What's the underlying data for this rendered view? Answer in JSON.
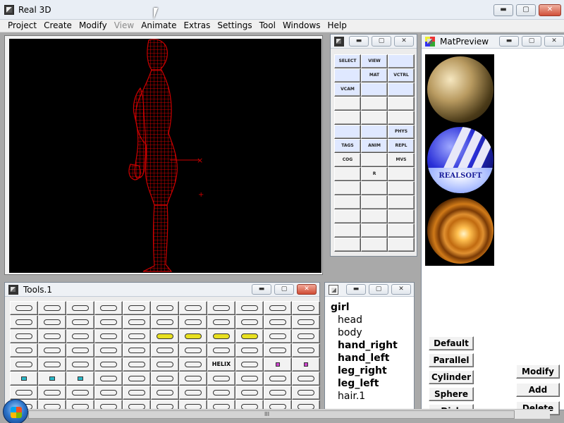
{
  "app": {
    "title": "Real 3D",
    "window_buttons": {
      "minimize": "▬",
      "maximize": "▢",
      "close": "✕"
    }
  },
  "menubar": [
    {
      "label": "Project",
      "enabled": true
    },
    {
      "label": "Create",
      "enabled": true
    },
    {
      "label": "Modify",
      "enabled": true
    },
    {
      "label": "View",
      "enabled": false
    },
    {
      "label": "Animate",
      "enabled": true
    },
    {
      "label": "Extras",
      "enabled": true
    },
    {
      "label": "Settings",
      "enabled": true
    },
    {
      "label": "Tool",
      "enabled": true
    },
    {
      "label": "Windows",
      "enabled": true
    },
    {
      "label": "Help",
      "enabled": true
    }
  ],
  "palette": {
    "buttons": [
      [
        "SELECT",
        "VIEW",
        ""
      ],
      [
        "",
        "MAT",
        "VCTRL"
      ],
      [
        "VCAM",
        "",
        ""
      ],
      [
        "",
        "",
        ""
      ],
      [
        "",
        "",
        ""
      ],
      [
        "",
        "",
        "PHYS"
      ],
      [
        "TAGS",
        "ANIM",
        "REPL TAGS"
      ],
      [
        "COG",
        "",
        "MVS"
      ],
      [
        "",
        "R",
        ""
      ],
      [
        "",
        "",
        ""
      ],
      [
        "",
        "",
        ""
      ],
      [
        "",
        "",
        ""
      ],
      [
        "",
        "",
        ""
      ],
      [
        "",
        "",
        ""
      ]
    ]
  },
  "matpreview": {
    "title": "MatPreview",
    "sphere_brand": "REALSOFT",
    "buttons": [
      "Default",
      "Parallel",
      "Cylinder",
      "Sphere",
      "Disk"
    ],
    "side_buttons": [
      "Modify",
      "Add",
      "Delete"
    ]
  },
  "tools_window": {
    "title": "Tools.1",
    "helix_label": "HELIX",
    "rows": 8,
    "cols": 11
  },
  "hierarchy": {
    "root": "girl",
    "children": [
      {
        "label": "head",
        "bold": false
      },
      {
        "label": "body",
        "bold": false
      },
      {
        "label": "hand_right",
        "bold": true
      },
      {
        "label": "hand_left",
        "bold": true
      },
      {
        "label": "leg_right",
        "bold": true
      },
      {
        "label": "leg_left",
        "bold": true
      },
      {
        "label": "hair.1",
        "bold": false
      }
    ]
  },
  "colors": {
    "viewport_bg": "#000000",
    "wireframe": "#cc0000",
    "workspace": "#a9a9a9"
  },
  "scrollbar": {
    "grip": "III"
  }
}
